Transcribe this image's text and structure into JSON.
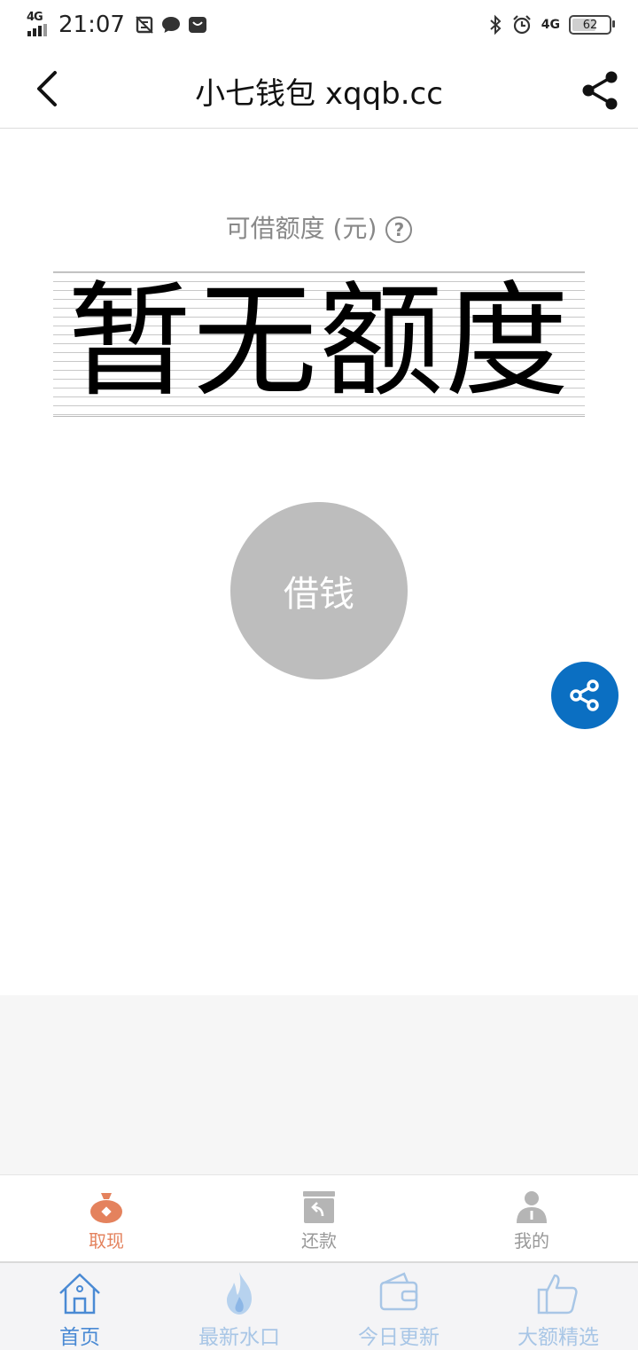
{
  "status_bar": {
    "network_label": "4G",
    "time": "21:07",
    "right_network": "4G",
    "battery_level": "62"
  },
  "header": {
    "title": "小七钱包 xqqb.cc"
  },
  "main": {
    "quota_label": "可借额度 (元)",
    "help_glyph": "?",
    "quota_value": "暂无额度",
    "borrow_label": "借钱"
  },
  "inner_tabs": [
    {
      "label": "取现",
      "icon": "money-bag-icon",
      "active": true,
      "color": "#e4825d"
    },
    {
      "label": "还款",
      "icon": "repay-box-icon",
      "active": false,
      "color": "#999999"
    },
    {
      "label": "我的",
      "icon": "person-icon",
      "active": false,
      "color": "#999999"
    }
  ],
  "outer_tabs": [
    {
      "label": "首页",
      "icon": "home-icon",
      "active": true
    },
    {
      "label": "最新水口",
      "icon": "flame-icon",
      "active": false
    },
    {
      "label": "今日更新",
      "icon": "wallet-icon",
      "active": false
    },
    {
      "label": "大额精选",
      "icon": "thumbs-up-icon",
      "active": false
    }
  ],
  "colors": {
    "accent_blue": "#0b6fc2",
    "tab_active_orange": "#e4825d",
    "tab_blue_active": "#4a8ad4",
    "tab_blue_inactive": "#a8c6e6",
    "borrow_button_gray": "#bdbdbd"
  }
}
